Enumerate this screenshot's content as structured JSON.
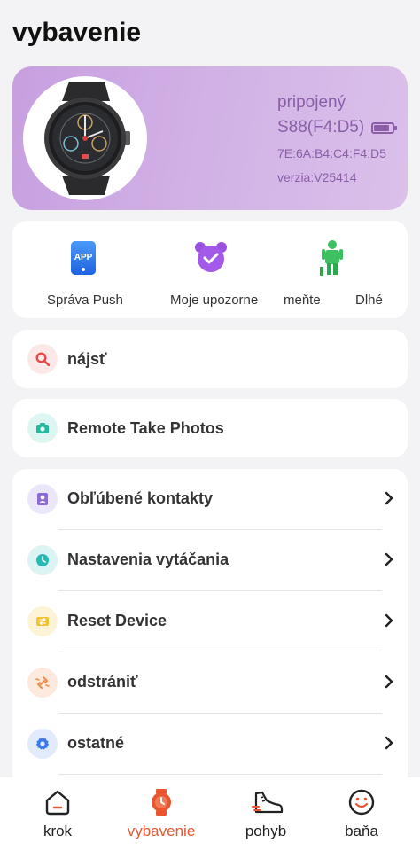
{
  "page": {
    "title": "vybavenie"
  },
  "device": {
    "status": "pripojený",
    "name": "S88(F4:D5)",
    "mac": "7E:6A:B4:C4:F4:D5",
    "version": "verzia:V25414",
    "battery_level": 0.85,
    "accent_color": "#8a5fa8"
  },
  "quick_actions": [
    {
      "label": "Správa Push",
      "icon": "app-notification-icon"
    },
    {
      "label": "Moje upozorne",
      "icon": "alarm-clock-icon"
    },
    {
      "label": "meňte",
      "icon": "sedentary-person-icon"
    },
    {
      "label": "Dlhé",
      "icon": "long-sit-icon"
    }
  ],
  "find": {
    "label": "nájsť",
    "icon": "search-icon"
  },
  "remote_photo": {
    "label": "Remote Take Photos",
    "icon": "camera-icon"
  },
  "settings_list": [
    {
      "label": "Obľúbené kontakty",
      "icon": "contacts-icon",
      "color": "#8e6ad8"
    },
    {
      "label": "Nastavenia vytáčania",
      "icon": "clock-icon",
      "color": "#27b9b2"
    },
    {
      "label": "Reset Device",
      "icon": "reset-icon",
      "color": "#f2c232"
    },
    {
      "label": "odstrániť",
      "icon": "unlink-icon",
      "color": "#f08a4a"
    },
    {
      "label": "ostatné",
      "icon": "gear-icon",
      "color": "#3a7be8"
    }
  ],
  "bottom_nav": [
    {
      "label": "krok",
      "icon": "home-icon",
      "active": false
    },
    {
      "label": "vybavenie",
      "icon": "watch-icon",
      "active": true
    },
    {
      "label": "pohyb",
      "icon": "shoe-icon",
      "active": false
    },
    {
      "label": "baňa",
      "icon": "smiley-icon",
      "active": false
    }
  ]
}
